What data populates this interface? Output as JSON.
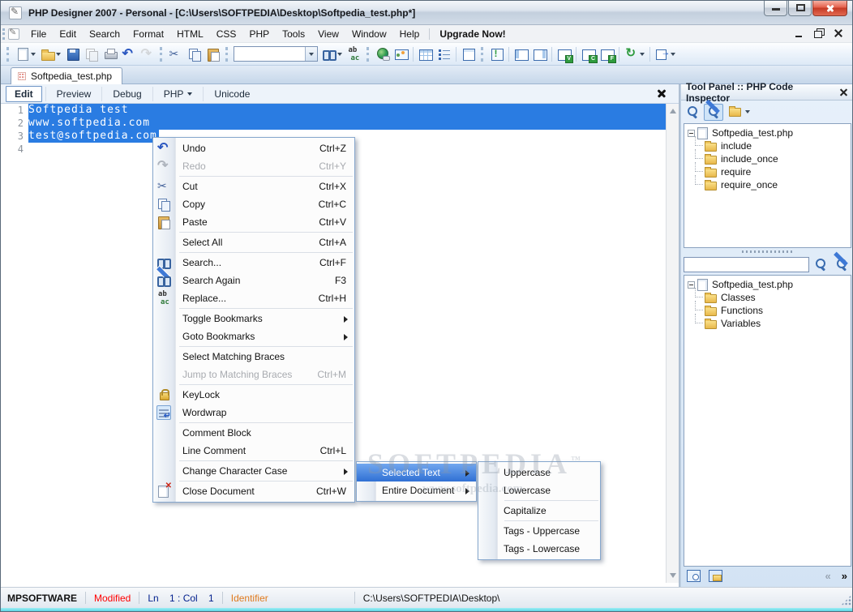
{
  "titlebar": {
    "title": "PHP Designer 2007 - Personal - [C:\\Users\\SOFTPEDIA\\Desktop\\Softpedia_test.php*]"
  },
  "menubar": {
    "items": [
      "File",
      "Edit",
      "Search",
      "Format",
      "HTML",
      "CSS",
      "PHP",
      "Tools",
      "View",
      "Window",
      "Help"
    ],
    "upgrade_label": "Upgrade Now!"
  },
  "toolbar": {
    "icons": [
      "new-document",
      "open",
      "save",
      "save-all",
      "print",
      "undo",
      "redo",
      "cut",
      "copy",
      "paste",
      "quick-search-combobox",
      "find",
      "replace",
      "insert-link",
      "insert-image",
      "insert-table",
      "insert-list",
      "insert-frame",
      "output-panel",
      "dock-left",
      "dock-right",
      "view-variables",
      "view-classes",
      "view-functions",
      "refresh",
      "export"
    ],
    "search_value": ""
  },
  "doc_tab": {
    "label": "Softpedia_test.php"
  },
  "view_tabs": {
    "edit": "Edit",
    "preview": "Preview",
    "debug": "Debug",
    "php": "PHP",
    "unicode": "Unicode"
  },
  "editor": {
    "lines": [
      {
        "num": "1",
        "text": "Softpedia test"
      },
      {
        "num": "2",
        "text": "www.softpedia.com"
      },
      {
        "num": "3",
        "text": "test@softpedia.com"
      },
      {
        "num": "4",
        "text": ""
      }
    ]
  },
  "context_menu": {
    "items": [
      {
        "label": "Undo",
        "shortcut": "Ctrl+Z"
      },
      {
        "label": "Redo",
        "shortcut": "Ctrl+Y"
      },
      {
        "label": "Cut",
        "shortcut": "Ctrl+X"
      },
      {
        "label": "Copy",
        "shortcut": "Ctrl+C"
      },
      {
        "label": "Paste",
        "shortcut": "Ctrl+V"
      },
      {
        "label": "Select All",
        "shortcut": "Ctrl+A"
      },
      {
        "label": "Search...",
        "shortcut": "Ctrl+F"
      },
      {
        "label": "Search Again",
        "shortcut": "F3"
      },
      {
        "label": "Replace...",
        "shortcut": "Ctrl+H"
      },
      {
        "label": "Toggle Bookmarks",
        "shortcut": ""
      },
      {
        "label": "Goto Bookmarks",
        "shortcut": ""
      },
      {
        "label": "Select Matching Braces",
        "shortcut": ""
      },
      {
        "label": "Jump to Matching Braces",
        "shortcut": "Ctrl+M"
      },
      {
        "label": "KeyLock",
        "shortcut": ""
      },
      {
        "label": "Wordwrap",
        "shortcut": ""
      },
      {
        "label": "Comment Block",
        "shortcut": ""
      },
      {
        "label": "Line Comment",
        "shortcut": "Ctrl+L"
      },
      {
        "label": "Change Character Case",
        "shortcut": ""
      },
      {
        "label": "Close Document",
        "shortcut": "Ctrl+W"
      }
    ]
  },
  "case_submenu": {
    "items": [
      {
        "label": "Selected Text"
      },
      {
        "label": "Entire Document"
      }
    ]
  },
  "case_options": {
    "items": [
      {
        "label": "Uppercase"
      },
      {
        "label": "Lowercase"
      },
      {
        "label": "Capitalize"
      },
      {
        "label": "Tags - Uppercase"
      },
      {
        "label": "Tags - Lowercase"
      }
    ]
  },
  "tool_panel": {
    "title": "Tool Panel :: PHP Code Inspector",
    "inspector_tree": {
      "root": "Softpedia_test.php",
      "children": [
        "include",
        "include_once",
        "require",
        "require_once"
      ]
    },
    "search_value": "",
    "code_tree": {
      "root": "Softpedia_test.php",
      "children": [
        "Classes",
        "Functions",
        "Variables"
      ]
    },
    "nav": {
      "prev": "«",
      "next": "»"
    }
  },
  "statusbar": {
    "brand": "MPSOFTWARE",
    "modified": "Modified",
    "position": "Ln    1 : Col    1",
    "mode": "Identifier",
    "path": "C:\\Users\\SOFTPEDIA\\Desktop\\"
  },
  "watermark": {
    "line1": "SOFTPEDIA",
    "tm": "™",
    "line2": "www.softpedia.com"
  },
  "colors": {
    "selection": "#2a7ce2",
    "modified_red": "#ff0000",
    "position_navy": "#001e8c",
    "mode_orange": "#df7a1e"
  }
}
